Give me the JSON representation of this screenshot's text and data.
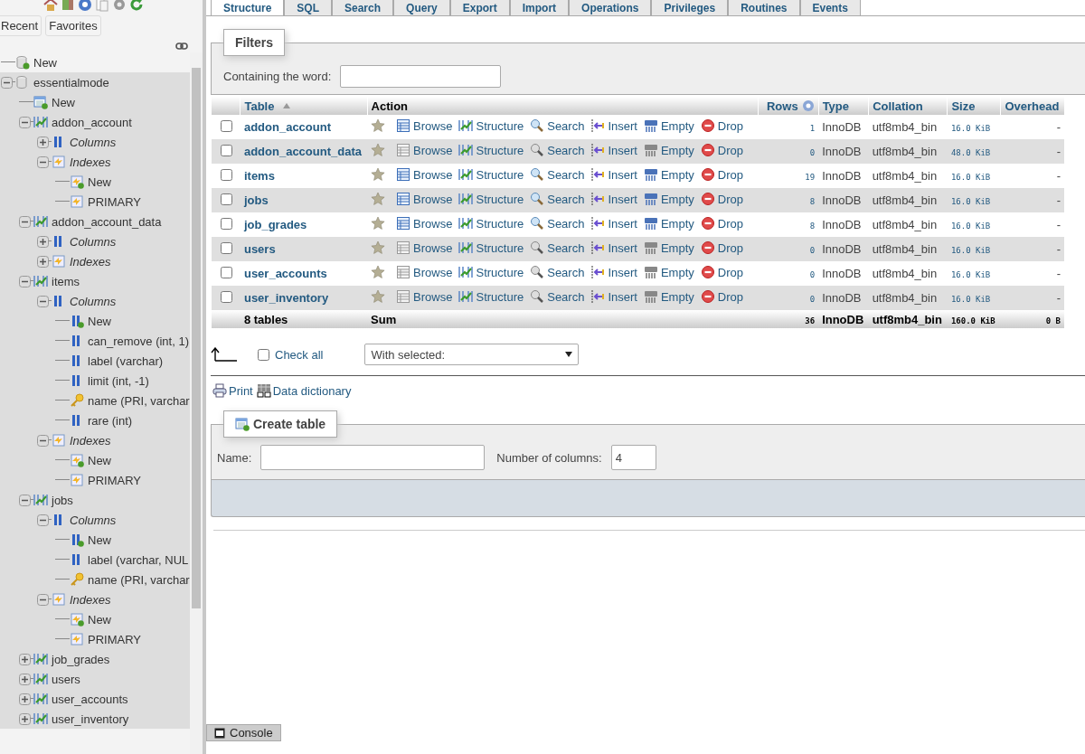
{
  "sidebar": {
    "buttons": [
      {
        "label": "Recent"
      },
      {
        "label": "Favorites"
      }
    ],
    "tree": [
      {
        "label": "New",
        "kind": "new_db"
      },
      {
        "label": "essentialmode",
        "kind": "db",
        "expanded": true,
        "children": [
          {
            "label": "New",
            "kind": "new_table"
          },
          {
            "label": "addon_account",
            "kind": "table",
            "expanded": true,
            "children": [
              {
                "label": "Columns",
                "kind": "columns",
                "expanded": false
              },
              {
                "label": "Indexes",
                "kind": "indexes",
                "expanded": true,
                "children": [
                  {
                    "label": "New",
                    "kind": "new_index"
                  },
                  {
                    "label": "PRIMARY",
                    "kind": "index"
                  }
                ]
              }
            ]
          },
          {
            "label": "addon_account_data",
            "kind": "table",
            "expanded": true,
            "children": [
              {
                "label": "Columns",
                "kind": "columns",
                "expanded": false
              },
              {
                "label": "Indexes",
                "kind": "indexes",
                "expanded": false
              }
            ]
          },
          {
            "label": "items",
            "kind": "table",
            "expanded": true,
            "children": [
              {
                "label": "Columns",
                "kind": "columns",
                "expanded": true,
                "children": [
                  {
                    "label": "New",
                    "kind": "new_column"
                  },
                  {
                    "label": "can_remove (int, 1)",
                    "kind": "column"
                  },
                  {
                    "label": "label (varchar)",
                    "kind": "column"
                  },
                  {
                    "label": "limit (int, -1)",
                    "kind": "column"
                  },
                  {
                    "label": "name (PRI, varchar",
                    "kind": "key_column"
                  },
                  {
                    "label": "rare (int)",
                    "kind": "column"
                  }
                ]
              },
              {
                "label": "Indexes",
                "kind": "indexes",
                "expanded": true,
                "children": [
                  {
                    "label": "New",
                    "kind": "new_index"
                  },
                  {
                    "label": "PRIMARY",
                    "kind": "index"
                  }
                ]
              }
            ]
          },
          {
            "label": "jobs",
            "kind": "table",
            "expanded": true,
            "children": [
              {
                "label": "Columns",
                "kind": "columns",
                "expanded": true,
                "children": [
                  {
                    "label": "New",
                    "kind": "new_column"
                  },
                  {
                    "label": "label (varchar, NUL",
                    "kind": "column"
                  },
                  {
                    "label": "name (PRI, varchar",
                    "kind": "key_column"
                  }
                ]
              },
              {
                "label": "Indexes",
                "kind": "indexes",
                "expanded": true,
                "children": [
                  {
                    "label": "New",
                    "kind": "new_index"
                  },
                  {
                    "label": "PRIMARY",
                    "kind": "index"
                  }
                ]
              }
            ]
          },
          {
            "label": "job_grades",
            "kind": "table",
            "expanded": false
          },
          {
            "label": "users",
            "kind": "table",
            "expanded": false
          },
          {
            "label": "user_accounts",
            "kind": "table",
            "expanded": false
          },
          {
            "label": "user_inventory",
            "kind": "table",
            "expanded": false
          }
        ]
      }
    ]
  },
  "tabs": [
    {
      "label": "Structure",
      "selected": true
    },
    {
      "label": "SQL",
      "selected": false
    },
    {
      "label": "Search",
      "selected": false
    },
    {
      "label": "Query",
      "selected": false
    },
    {
      "label": "Export",
      "selected": false
    },
    {
      "label": "Import",
      "selected": false
    },
    {
      "label": "Operations",
      "selected": false
    },
    {
      "label": "Privileges",
      "selected": false
    },
    {
      "label": "Routines",
      "selected": false
    },
    {
      "label": "Events",
      "selected": false
    }
  ],
  "filters": {
    "legend": "Filters",
    "label": "Containing the word:"
  },
  "table": {
    "columns": [
      "Table",
      "Action",
      "Rows",
      "Type",
      "Collation",
      "Size",
      "Overhead"
    ],
    "rows": [
      {
        "name": "addon_account",
        "checked": false,
        "empty": false,
        "actions": [
          {
            "kind": "browse",
            "label": "Browse"
          },
          {
            "kind": "structure",
            "label": "Structure"
          },
          {
            "kind": "search",
            "label": "Search"
          },
          {
            "kind": "insert",
            "label": "Insert"
          },
          {
            "kind": "empty",
            "label": "Empty"
          },
          {
            "kind": "drop",
            "label": "Drop"
          }
        ],
        "rows": "1",
        "type": "InnoDB",
        "collation": "utf8mb4_bin",
        "size": "16.0 KiB",
        "overhead": "-"
      },
      {
        "name": "addon_account_data",
        "checked": false,
        "empty": true,
        "actions": [
          {
            "kind": "browse",
            "label": "Browse"
          },
          {
            "kind": "structure",
            "label": "Structure"
          },
          {
            "kind": "search",
            "label": "Search"
          },
          {
            "kind": "insert",
            "label": "Insert"
          },
          {
            "kind": "empty",
            "label": "Empty"
          },
          {
            "kind": "drop",
            "label": "Drop"
          }
        ],
        "rows": "0",
        "type": "InnoDB",
        "collation": "utf8mb4_bin",
        "size": "48.0 KiB",
        "overhead": "-"
      },
      {
        "name": "items",
        "checked": false,
        "empty": false,
        "actions": [
          {
            "kind": "browse",
            "label": "Browse"
          },
          {
            "kind": "structure",
            "label": "Structure"
          },
          {
            "kind": "search",
            "label": "Search"
          },
          {
            "kind": "insert",
            "label": "Insert"
          },
          {
            "kind": "empty",
            "label": "Empty"
          },
          {
            "kind": "drop",
            "label": "Drop"
          }
        ],
        "rows": "19",
        "type": "InnoDB",
        "collation": "utf8mb4_bin",
        "size": "16.0 KiB",
        "overhead": "-"
      },
      {
        "name": "jobs",
        "checked": false,
        "empty": false,
        "actions": [
          {
            "kind": "browse",
            "label": "Browse"
          },
          {
            "kind": "structure",
            "label": "Structure"
          },
          {
            "kind": "search",
            "label": "Search"
          },
          {
            "kind": "insert",
            "label": "Insert"
          },
          {
            "kind": "empty",
            "label": "Empty"
          },
          {
            "kind": "drop",
            "label": "Drop"
          }
        ],
        "rows": "8",
        "type": "InnoDB",
        "collation": "utf8mb4_bin",
        "size": "16.0 KiB",
        "overhead": "-"
      },
      {
        "name": "job_grades",
        "checked": false,
        "empty": false,
        "actions": [
          {
            "kind": "browse",
            "label": "Browse"
          },
          {
            "kind": "structure",
            "label": "Structure"
          },
          {
            "kind": "search",
            "label": "Search"
          },
          {
            "kind": "insert",
            "label": "Insert"
          },
          {
            "kind": "empty",
            "label": "Empty"
          },
          {
            "kind": "drop",
            "label": "Drop"
          }
        ],
        "rows": "8",
        "type": "InnoDB",
        "collation": "utf8mb4_bin",
        "size": "16.0 KiB",
        "overhead": "-"
      },
      {
        "name": "users",
        "checked": false,
        "empty": true,
        "actions": [
          {
            "kind": "browse",
            "label": "Browse"
          },
          {
            "kind": "structure",
            "label": "Structure"
          },
          {
            "kind": "search",
            "label": "Search"
          },
          {
            "kind": "insert",
            "label": "Insert"
          },
          {
            "kind": "empty",
            "label": "Empty"
          },
          {
            "kind": "drop",
            "label": "Drop"
          }
        ],
        "rows": "0",
        "type": "InnoDB",
        "collation": "utf8mb4_bin",
        "size": "16.0 KiB",
        "overhead": "-"
      },
      {
        "name": "user_accounts",
        "checked": false,
        "empty": true,
        "actions": [
          {
            "kind": "browse",
            "label": "Browse"
          },
          {
            "kind": "structure",
            "label": "Structure"
          },
          {
            "kind": "search",
            "label": "Search"
          },
          {
            "kind": "insert",
            "label": "Insert"
          },
          {
            "kind": "empty",
            "label": "Empty"
          },
          {
            "kind": "drop",
            "label": "Drop"
          }
        ],
        "rows": "0",
        "type": "InnoDB",
        "collation": "utf8mb4_bin",
        "size": "16.0 KiB",
        "overhead": "-"
      },
      {
        "name": "user_inventory",
        "checked": false,
        "empty": true,
        "actions": [
          {
            "kind": "browse",
            "label": "Browse"
          },
          {
            "kind": "structure",
            "label": "Structure"
          },
          {
            "kind": "search",
            "label": "Search"
          },
          {
            "kind": "insert",
            "label": "Insert"
          },
          {
            "kind": "empty",
            "label": "Empty"
          },
          {
            "kind": "drop",
            "label": "Drop"
          }
        ],
        "rows": "0",
        "type": "InnoDB",
        "collation": "utf8mb4_bin",
        "size": "16.0 KiB",
        "overhead": "-"
      }
    ],
    "footer": {
      "label": "8 tables",
      "action": "Sum",
      "rows": "36",
      "type": "InnoDB",
      "collation": "utf8mb4_bin",
      "size": "160.0 KiB",
      "overhead": "0 B"
    }
  },
  "bulk": {
    "check_all": "Check all",
    "checked": false,
    "with_selected": "With selected:"
  },
  "links": [
    {
      "kind": "print",
      "label": "Print"
    },
    {
      "kind": "dictionary",
      "label": "Data dictionary"
    }
  ],
  "create_table": {
    "legend": "Create table",
    "name_label": "Name:",
    "columns_label": "Number of columns:",
    "columns_value": "4"
  },
  "console": {
    "label": "Console"
  }
}
